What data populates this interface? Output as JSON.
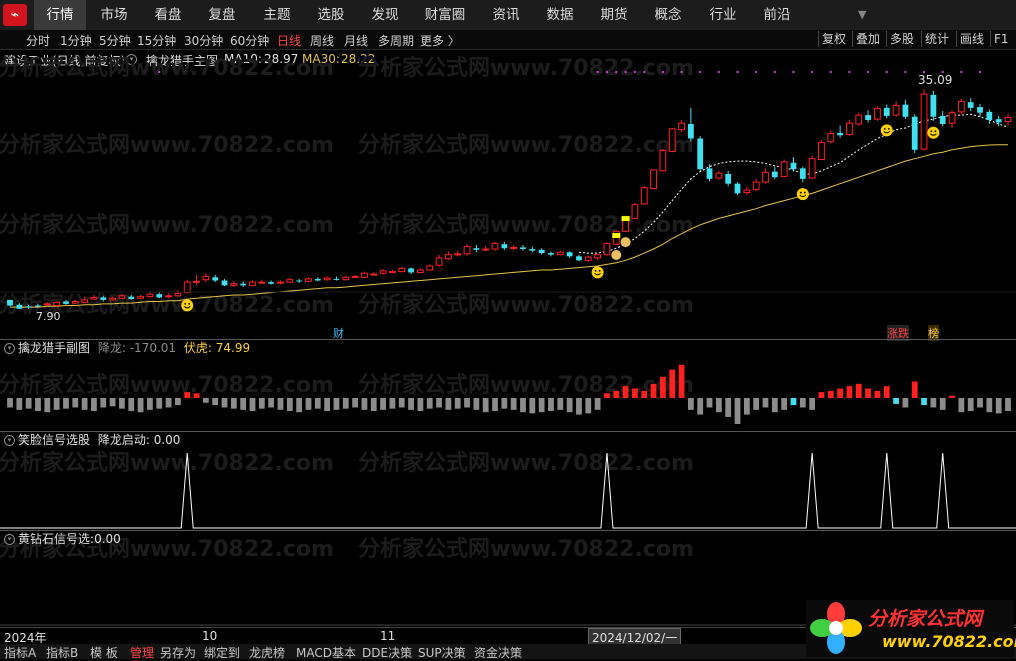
{
  "nav": {
    "logo_glyph": "⌁",
    "items": [
      "行情",
      "市场",
      "看盘",
      "复盘",
      "主题",
      "选股",
      "发现",
      "财富圈",
      "资讯",
      "数据",
      "期货",
      "概念",
      "行业",
      "前沿"
    ],
    "active": 0
  },
  "toolbar": {
    "periods": [
      "分时",
      "1分钟",
      "5分钟",
      "15分钟",
      "30分钟",
      "60分钟",
      "日线",
      "周线",
      "月线",
      "多周期",
      "更多 〉"
    ],
    "active_period": "日线",
    "right_buttons": [
      "复权",
      "叠加",
      "多股",
      "统计",
      "画线",
      "F1"
    ]
  },
  "main_panel": {
    "stock_name": "建设工业",
    "stock_mode": "(日线,前复权)",
    "indicator_name": "擒龙猎手主图",
    "ma10_label": "MA10:",
    "ma10_value": "28.97",
    "ma30_label": "MA30:",
    "ma30_value": "28.22",
    "high_label": "35.09",
    "low_label": "7.90",
    "event_tags": [
      "财",
      "涨跌",
      "榜"
    ]
  },
  "sub_panel_1": {
    "name": "擒龙猎手副图",
    "jianglong_label": "降龙:",
    "jianglong_value": "-170.01",
    "fuhu_label": "伏虎:",
    "fuhu_value": "74.99"
  },
  "sub_panel_2": {
    "name": "笑脸信号选股",
    "field_label": "降龙启动:",
    "field_value": "0.00"
  },
  "sub_panel_3": {
    "name": "黄钻石信号选",
    "field_label": ":",
    "field_value": "0.00"
  },
  "time_axis": {
    "labels": [
      "2024年",
      "10",
      "11"
    ],
    "cursor_date": "2024/12/02/一"
  },
  "status_bar": {
    "items": [
      "指标A",
      "指标B",
      "模 板",
      "管理",
      "另存为",
      "绑定到",
      "龙虎榜",
      "MACD基本",
      "DDE决策",
      "SUP决策",
      "资金决策"
    ]
  },
  "watermark": {
    "text": "分析家公式网www.70822.com"
  },
  "brand": {
    "name": "分析家公式网",
    "url": "www.70822.com"
  },
  "colors": {
    "up": "#ff2020",
    "down": "#40e0f0",
    "ma30": "#e6c34a",
    "neutral_bar": "#8c8c8c",
    "active_period": "#ff4040",
    "signal_dot": "#d040d0"
  },
  "chart_data": {
    "type": "candlestick",
    "candles": [
      [
        9.0,
        8.3,
        8.9,
        8.2
      ],
      [
        8.4,
        7.9,
        8.6,
        7.9
      ],
      [
        8.2,
        8.1,
        8.4,
        7.9
      ],
      [
        8.3,
        8.2,
        8.5,
        8.0
      ],
      [
        8.4,
        8.5,
        8.7,
        8.2
      ],
      [
        8.3,
        8.7,
        8.8,
        8.2
      ],
      [
        8.8,
        8.5,
        9.0,
        8.4
      ],
      [
        8.6,
        8.8,
        9.0,
        8.5
      ],
      [
        8.7,
        9.0,
        9.4,
        8.6
      ],
      [
        9.1,
        9.3,
        9.6,
        9.0
      ],
      [
        9.3,
        9.0,
        9.5,
        8.8
      ],
      [
        9.0,
        9.2,
        9.4,
        8.9
      ],
      [
        9.2,
        9.5,
        9.7,
        9.1
      ],
      [
        9.4,
        9.1,
        9.6,
        9.0
      ],
      [
        9.2,
        9.4,
        9.6,
        9.1
      ],
      [
        9.4,
        9.7,
        10.0,
        9.3
      ],
      [
        9.7,
        9.3,
        9.9,
        9.2
      ],
      [
        9.4,
        9.5,
        9.8,
        9.2
      ],
      [
        9.5,
        9.8,
        10.2,
        9.4
      ],
      [
        9.9,
        11.2,
        11.5,
        9.8
      ],
      [
        11.2,
        11.3,
        12.1,
        10.8
      ],
      [
        11.5,
        11.9,
        12.3,
        11.2
      ],
      [
        11.8,
        11.4,
        12.1,
        11.2
      ],
      [
        11.4,
        10.8,
        11.6,
        10.7
      ],
      [
        10.8,
        11.0,
        11.3,
        10.6
      ],
      [
        11.0,
        10.8,
        11.3,
        10.6
      ],
      [
        10.8,
        11.2,
        11.4,
        10.7
      ],
      [
        11.1,
        11.2,
        11.5,
        11.0
      ],
      [
        11.2,
        11.0,
        11.4,
        10.9
      ],
      [
        11.1,
        11.2,
        11.4,
        10.9
      ],
      [
        11.2,
        11.5,
        11.7,
        11.1
      ],
      [
        11.4,
        11.3,
        11.6,
        11.1
      ],
      [
        11.3,
        11.6,
        11.8,
        11.2
      ],
      [
        11.6,
        11.4,
        11.8,
        11.3
      ],
      [
        11.5,
        11.7,
        11.9,
        11.4
      ],
      [
        11.6,
        11.5,
        11.9,
        11.4
      ],
      [
        11.5,
        11.8,
        12.0,
        11.4
      ],
      [
        11.8,
        11.9,
        12.1,
        11.7
      ],
      [
        11.8,
        12.3,
        12.5,
        11.7
      ],
      [
        12.2,
        12.2,
        12.4,
        12.0
      ],
      [
        12.3,
        12.6,
        12.8,
        12.1
      ],
      [
        12.5,
        12.5,
        12.7,
        12.4
      ],
      [
        12.5,
        12.9,
        13.1,
        12.4
      ],
      [
        12.9,
        12.4,
        13.0,
        12.2
      ],
      [
        12.4,
        12.7,
        12.9,
        12.3
      ],
      [
        12.7,
        13.2,
        13.4,
        12.6
      ],
      [
        13.3,
        14.2,
        14.6,
        13.1
      ],
      [
        14.1,
        14.6,
        15.0,
        13.9
      ],
      [
        14.6,
        14.7,
        15.1,
        14.4
      ],
      [
        14.7,
        15.6,
        15.9,
        14.5
      ],
      [
        15.4,
        15.2,
        15.8,
        14.9
      ],
      [
        15.2,
        15.3,
        15.7,
        15.0
      ],
      [
        15.3,
        16.0,
        16.2,
        15.1
      ],
      [
        15.9,
        15.4,
        16.2,
        15.2
      ],
      [
        15.4,
        15.5,
        15.8,
        15.2
      ],
      [
        15.5,
        15.3,
        15.8,
        15.1
      ],
      [
        15.3,
        15.1,
        15.6,
        14.9
      ],
      [
        15.2,
        14.8,
        15.4,
        14.6
      ],
      [
        14.8,
        14.6,
        15.0,
        14.4
      ],
      [
        14.6,
        14.9,
        15.1,
        14.5
      ],
      [
        14.9,
        14.4,
        15.0,
        14.2
      ],
      [
        14.4,
        13.9,
        14.6,
        13.8
      ],
      [
        13.9,
        14.3,
        14.5,
        13.7
      ],
      [
        14.2,
        14.6,
        14.7,
        13.9
      ],
      [
        14.6,
        16.0,
        16.1,
        14.5
      ],
      [
        15.9,
        17.5,
        17.6,
        15.8
      ],
      [
        17.5,
        19.2,
        19.3,
        17.4
      ],
      [
        19.1,
        20.8,
        21.0,
        19.0
      ],
      [
        20.9,
        22.9,
        23.1,
        20.8
      ],
      [
        22.8,
        25.1,
        25.2,
        22.7
      ],
      [
        25.0,
        27.5,
        27.7,
        24.9
      ],
      [
        27.4,
        30.2,
        30.3,
        27.3
      ],
      [
        30.1,
        30.9,
        31.3,
        29.8
      ],
      [
        30.8,
        29.0,
        32.8,
        28.6
      ],
      [
        29.0,
        25.2,
        29.3,
        25.0
      ],
      [
        25.3,
        24.0,
        25.8,
        23.7
      ],
      [
        24.1,
        24.7,
        25.0,
        23.9
      ],
      [
        24.6,
        23.4,
        25.0,
        23.1
      ],
      [
        23.4,
        22.2,
        23.6,
        22.0
      ],
      [
        22.3,
        22.6,
        23.0,
        22.0
      ],
      [
        22.7,
        23.6,
        24.0,
        22.5
      ],
      [
        23.6,
        24.8,
        25.3,
        23.4
      ],
      [
        24.9,
        24.2,
        25.5,
        24.0
      ],
      [
        24.3,
        26.1,
        26.4,
        24.2
      ],
      [
        26.0,
        25.2,
        26.7,
        24.9
      ],
      [
        25.3,
        24.0,
        25.5,
        23.6
      ],
      [
        24.1,
        26.5,
        26.9,
        24.0
      ],
      [
        26.4,
        28.5,
        28.8,
        26.3
      ],
      [
        28.6,
        29.6,
        30.0,
        28.4
      ],
      [
        29.7,
        29.4,
        30.6,
        29.1
      ],
      [
        29.5,
        30.9,
        31.3,
        29.3
      ],
      [
        30.8,
        31.9,
        32.2,
        30.6
      ],
      [
        31.9,
        31.3,
        32.5,
        31.0
      ],
      [
        31.4,
        32.7,
        33.0,
        31.2
      ],
      [
        32.8,
        31.8,
        33.2,
        31.5
      ],
      [
        31.9,
        33.1,
        33.6,
        31.7
      ],
      [
        33.2,
        31.7,
        33.8,
        31.4
      ],
      [
        31.7,
        27.6,
        32.0,
        27.2
      ],
      [
        27.7,
        34.5,
        35.09,
        27.5
      ],
      [
        34.4,
        31.7,
        34.9,
        31.2
      ],
      [
        31.8,
        30.8,
        32.4,
        30.5
      ],
      [
        30.9,
        32.2,
        32.5,
        30.3
      ],
      [
        32.3,
        33.6,
        33.9,
        32.0
      ],
      [
        33.5,
        32.8,
        34.0,
        32.4
      ],
      [
        32.9,
        32.2,
        33.3,
        31.7
      ],
      [
        32.3,
        31.3,
        32.6,
        30.8
      ],
      [
        31.4,
        31.0,
        31.8,
        30.5
      ],
      [
        31.1,
        31.6,
        32.0,
        30.6
      ]
    ],
    "ma30": [
      8.1,
      8.1,
      8.1,
      8.1,
      8.2,
      8.2,
      8.3,
      8.3,
      8.4,
      8.4,
      8.5,
      8.5,
      8.6,
      8.6,
      8.7,
      8.8,
      8.8,
      8.9,
      8.9,
      9.1,
      9.2,
      9.3,
      9.4,
      9.5,
      9.6,
      9.6,
      9.7,
      9.8,
      9.9,
      10.0,
      10.1,
      10.2,
      10.3,
      10.4,
      10.5,
      10.5,
      10.6,
      10.7,
      10.8,
      10.9,
      11.0,
      11.1,
      11.2,
      11.3,
      11.4,
      11.5,
      11.6,
      11.7,
      11.8,
      11.9,
      12.0,
      12.1,
      12.2,
      12.3,
      12.4,
      12.5,
      12.6,
      12.7,
      12.7,
      12.8,
      12.9,
      13.0,
      13.1,
      13.2,
      13.4,
      13.6,
      13.9,
      14.3,
      14.8,
      15.3,
      15.9,
      16.6,
      17.2,
      17.8,
      18.3,
      18.7,
      19.1,
      19.4,
      19.7,
      20.0,
      20.3,
      20.7,
      21.0,
      21.3,
      21.6,
      21.9,
      22.2,
      22.6,
      23.0,
      23.4,
      23.8,
      24.2,
      24.6,
      25.0,
      25.4,
      25.8,
      26.2,
      26.5,
      26.8,
      27.1,
      27.3,
      27.6,
      27.8,
      28.0,
      28.1,
      28.2,
      28.22,
      28.22
    ],
    "ma10": [
      8.6,
      8.5,
      8.4,
      8.4,
      8.4,
      8.4,
      8.5,
      8.6,
      8.7,
      8.8,
      8.9,
      9.0,
      9.1,
      9.2,
      9.2,
      9.3,
      9.4,
      9.4,
      9.5,
      9.7,
      9.9,
      10.1,
      10.3,
      10.4,
      10.6,
      10.7,
      10.9,
      11.0,
      11.1,
      11.1,
      11.2,
      11.2,
      11.3,
      11.3,
      11.4,
      11.4,
      11.5,
      11.6,
      11.7,
      11.8,
      11.9,
      12.0,
      12.1,
      12.2,
      12.3,
      12.4,
      12.6,
      12.8,
      13.0,
      13.3,
      13.5,
      13.8,
      14.1,
      14.4,
      14.7,
      14.9,
      15.0,
      15.1,
      15.2,
      15.2,
      15.1,
      14.9,
      14.8,
      14.8,
      15.0,
      15.4,
      15.9,
      16.6,
      17.5,
      18.6,
      19.9,
      21.3,
      22.7,
      24.0,
      24.9,
      25.5,
      25.9,
      26.1,
      26.2,
      26.2,
      26.1,
      25.9,
      25.6,
      25.4,
      25.1,
      24.6,
      24.6,
      25.0,
      25.5,
      26.0,
      26.8,
      27.6,
      28.3,
      29.0,
      29.5,
      30.1,
      30.3,
      30.8,
      31.2,
      31.4,
      31.7,
      31.9,
      31.9,
      32.0,
      31.7,
      31.3,
      30.8,
      30.4
    ],
    "y_range": [
      7.0,
      36.5
    ],
    "sub1_values": [
      -8,
      -10,
      -9,
      -11,
      -12,
      -10,
      -9,
      -8,
      -10,
      -11,
      -8,
      -7,
      -9,
      -11,
      -12,
      -10,
      -9,
      -8,
      -6,
      5,
      4,
      -4,
      -6,
      -8,
      -9,
      -10,
      -11,
      -9,
      -8,
      -10,
      -11,
      -12,
      -10,
      -9,
      -11,
      -10,
      -9,
      -8,
      -10,
      -11,
      -10,
      -9,
      -8,
      -10,
      -11,
      -9,
      -8,
      -10,
      -9,
      -8,
      -10,
      -12,
      -11,
      -9,
      -10,
      -12,
      -13,
      -12,
      -11,
      -10,
      -12,
      -14,
      -13,
      -10,
      4,
      6,
      10,
      8,
      6,
      12,
      18,
      24,
      28,
      -10,
      -14,
      -8,
      -12,
      -16,
      -22,
      -14,
      -10,
      -8,
      -12,
      -10,
      -6,
      -8,
      -10,
      5,
      6,
      8,
      10,
      12,
      8,
      6,
      10,
      -5,
      -8,
      14,
      -6,
      -8,
      -10,
      2,
      -12,
      -11,
      -8,
      -12,
      -13,
      -11
    ],
    "sub1_range": [
      -25,
      35
    ],
    "sub2_signals": [
      19,
      64,
      86,
      94,
      100
    ],
    "signal_dots": [
      16,
      63,
      64,
      65,
      66,
      67,
      68,
      70,
      72,
      74,
      76,
      78,
      80,
      82,
      84,
      86,
      88,
      90,
      92,
      94,
      96,
      98,
      100,
      102,
      104
    ],
    "smiley_candles": [
      19,
      63,
      85,
      94,
      99
    ],
    "bag_candles": [
      65,
      66
    ]
  }
}
